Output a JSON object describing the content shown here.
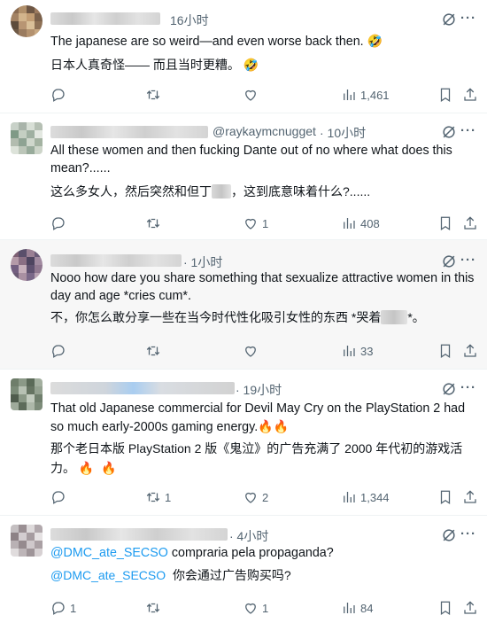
{
  "tweets": [
    {
      "handle": "",
      "time": "16小时",
      "text_en": "The japanese are so weird—and even worse back then.",
      "text_zh": "日本人真奇怪—— 而且当时更糟。",
      "emoji": "🤣",
      "replies": "",
      "retweets": "",
      "likes": "",
      "views": "1,461"
    },
    {
      "handle": "@raykaymcnugget",
      "time": "· 10小时",
      "text_en": "All these women and then fucking Dante out of no where what does this mean?......",
      "text_zh_a": "这么多女人，然后突然和但丁",
      "text_zh_b": "，这到底意味着什么?......",
      "replies": "",
      "retweets": "",
      "likes": "1",
      "views": "408"
    },
    {
      "handle": "",
      "time": "· 1小时",
      "text_en": "Nooo how dare you share something that sexualize attractive women in this day and age *cries cum*.",
      "text_zh_a": "不，你怎么敢分享一些在当今时代性化吸引女性的东西 *哭着",
      "text_zh_b": "*。",
      "replies": "",
      "retweets": "",
      "likes": "",
      "views": "33"
    },
    {
      "handle": "",
      "time": "· 19小时",
      "text_en": "That old Japanese commercial for Devil May Cry on the PlayStation 2 had so much early-2000s gaming energy.",
      "text_zh": "那个老日本版 PlayStation 2 版《鬼泣》的广告充满了 2000 年代初的游戏活力。",
      "emoji": "🔥🔥",
      "replies": "",
      "retweets": "1",
      "likes": "2",
      "views": "1,344"
    },
    {
      "handle": "",
      "time": "· 4小时",
      "mention": "@DMC_ate_SECSO",
      "text_en": "compraria pela propaganda?",
      "text_zh": "你会通过广告购买吗?",
      "replies": "1",
      "retweets": "",
      "likes": "1",
      "views": "84"
    }
  ],
  "colors": {
    "accent": "#1d9bf0",
    "muted": "#536471",
    "text": "#0f1419",
    "highlight_bg": "#f7f7f7"
  },
  "icons": [
    "reply-icon",
    "retweet-icon",
    "like-icon",
    "views-icon",
    "bookmark-icon",
    "share-icon",
    "grok-icon",
    "more-icon"
  ]
}
